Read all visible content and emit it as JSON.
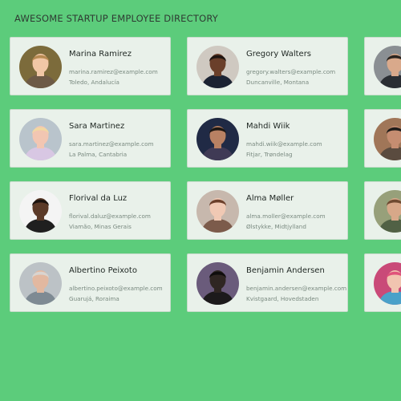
{
  "header": {
    "title": "AWESOME STARTUP EMPLOYEE DIRECTORY"
  },
  "employees": [
    {
      "name": "Marina Ramirez",
      "email": "marina.ramirez@example.com",
      "location": "Toledo, Andalucía",
      "avatar": {
        "skin": "#f1c7a6",
        "hair": "#b78a52",
        "bg": "#7c6b3b",
        "shirt": "#6d5a46"
      }
    },
    {
      "name": "Gregory Walters",
      "email": "gregory.walters@example.com",
      "location": "Duncanville, Montana",
      "avatar": {
        "skin": "#6a3f2a",
        "hair": "#1e1410",
        "bg": "#cfc9c1",
        "shirt": "#1b2333"
      }
    },
    {
      "name": "",
      "email": "",
      "location": "",
      "avatar": {
        "skin": "#d9a98b",
        "hair": "#2b2520",
        "bg": "#8a8f93",
        "shirt": "#2a2e33"
      }
    },
    {
      "name": "Sara Martinez",
      "email": "sara.martinez@example.com",
      "location": "La Palma, Cantabria",
      "avatar": {
        "skin": "#f2c6b2",
        "hair": "#f2d7a2",
        "bg": "#b9c4cc",
        "shirt": "#d8c7e3"
      }
    },
    {
      "name": "Mahdi Wiik",
      "email": "mahdi.wiik@example.com",
      "location": "Fitjar, Trøndelag",
      "avatar": {
        "skin": "#b88163",
        "hair": "#1d1712",
        "bg": "#202a45",
        "shirt": "#3f3a55"
      }
    },
    {
      "name": "",
      "email": "",
      "location": "",
      "avatar": {
        "skin": "#c58d71",
        "hair": "#1e1b19",
        "bg": "#a07658",
        "shirt": "#5a4b3f"
      }
    },
    {
      "name": "Florival da Luz",
      "email": "florival.daluz@example.com",
      "location": "Viamão, Minas Gerais",
      "avatar": {
        "skin": "#5b3a28",
        "hair": "#1b130f",
        "bg": "#f4f4f4",
        "shirt": "#1f1f1f"
      }
    },
    {
      "name": "Alma Møller",
      "email": "alma.moller@example.com",
      "location": "Ølstykke, Midtjylland",
      "avatar": {
        "skin": "#f0c9b4",
        "hair": "#6b3f2a",
        "bg": "#c7b8ad",
        "shirt": "#7c5b4b"
      }
    },
    {
      "name": "",
      "email": "",
      "location": "",
      "avatar": {
        "skin": "#d7a889",
        "hair": "#6e4a31",
        "bg": "#97a07a",
        "shirt": "#516145"
      }
    },
    {
      "name": "Albertino Peixoto",
      "email": "albertino.peixoto@example.com",
      "location": "Guarujá, Roraima",
      "avatar": {
        "skin": "#e2b8a0",
        "hair": "#d9d4cf",
        "bg": "#bcc2c6",
        "shirt": "#7e8a93"
      }
    },
    {
      "name": "Benjamin Andersen",
      "email": "benjamin.andersen@example.com",
      "location": "Kvistgaard, Hovedstaden",
      "avatar": {
        "skin": "#2f2622",
        "hair": "#0f0d0c",
        "bg": "#6a5b7b",
        "shirt": "#1c1a1b"
      }
    },
    {
      "name": "",
      "email": "",
      "location": "",
      "avatar": {
        "skin": "#f1c4b0",
        "hair": "#e0527a",
        "bg": "#c94a78",
        "shirt": "#4aa1c9"
      }
    }
  ]
}
